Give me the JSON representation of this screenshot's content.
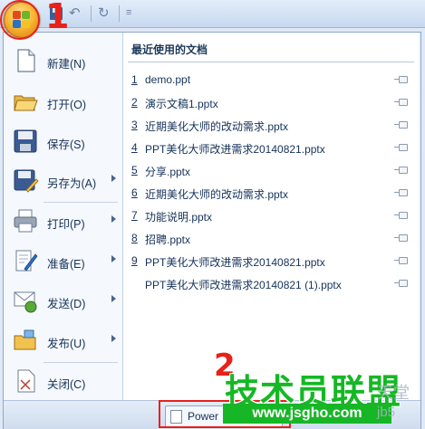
{
  "annotations": {
    "step1": "1",
    "step2": "2"
  },
  "qat": {
    "undo_glyph": "↶",
    "redo_glyph": "↻",
    "customize_glyph": "≡"
  },
  "left_menu": [
    {
      "label": "新建(N)",
      "has_submenu": false,
      "icon": "new-document-icon"
    },
    {
      "label": "打开(O)",
      "has_submenu": false,
      "icon": "open-folder-icon"
    },
    {
      "label": "保存(S)",
      "has_submenu": false,
      "icon": "save-disk-icon"
    },
    {
      "label": "另存为(A)",
      "has_submenu": true,
      "icon": "save-as-icon"
    },
    {
      "label": "打印(P)",
      "has_submenu": true,
      "icon": "printer-icon"
    },
    {
      "label": "准备(E)",
      "has_submenu": true,
      "icon": "prepare-icon"
    },
    {
      "label": "发送(D)",
      "has_submenu": true,
      "icon": "send-icon"
    },
    {
      "label": "发布(U)",
      "has_submenu": true,
      "icon": "publish-icon"
    },
    {
      "label": "关闭(C)",
      "has_submenu": false,
      "icon": "close-document-icon"
    }
  ],
  "recent": {
    "title": "最近使用的文档",
    "items": [
      {
        "num": "1",
        "name": "demo.ppt"
      },
      {
        "num": "2",
        "name": "演示文稿1.pptx"
      },
      {
        "num": "3",
        "name": "近期美化大师的改动需求.pptx"
      },
      {
        "num": "4",
        "name": "PPT美化大师改进需求20140821.pptx"
      },
      {
        "num": "5",
        "name": "分享.pptx"
      },
      {
        "num": "6",
        "name": "近期美化大师的改动需求.pptx"
      },
      {
        "num": "7",
        "name": "功能说明.pptx"
      },
      {
        "num": "8",
        "name": "招聘.pptx"
      },
      {
        "num": "9",
        "name": "PPT美化大师改进需求20140821.pptx"
      },
      {
        "num": "",
        "name": "PPT美化大师改进需求20140821 (1).pptx"
      }
    ]
  },
  "bottom": {
    "options_label": "Power"
  },
  "watermark": {
    "cn": "技术员联盟",
    "url": "www.jsgho.com",
    "side1": "天堂",
    "side2": "jb5"
  },
  "colors": {
    "accent_red": "#e8211a",
    "watermark_green": "#17b626",
    "office_orange": "#f7b733"
  }
}
